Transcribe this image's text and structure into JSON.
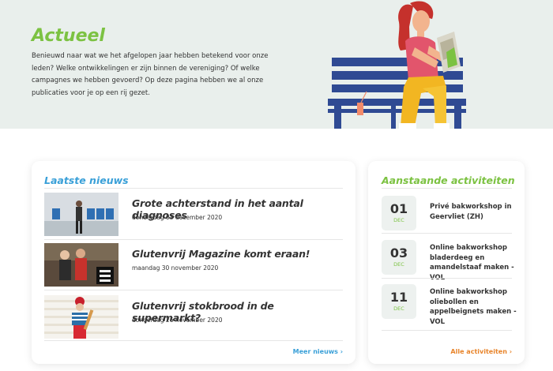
{
  "hero": {
    "title": "Actueel",
    "text": "Benieuwd naar wat we het afgelopen jaar hebben betekend voor onze leden? Welke ontwikkelingen er zijn binnen de vereniging? Of welke campagnes we hebben gevoerd? Op deze pagina hebben we al onze publicaties voor je op een rij gezet."
  },
  "news": {
    "title": "Laatste nieuws",
    "items": [
      {
        "headline": "Grote achterstand in het aantal diagnoses",
        "date": "donderdag 03 december 2020"
      },
      {
        "headline": "Glutenvrij Magazine komt eraan!",
        "date": "maandag 30 november 2020"
      },
      {
        "headline": "Glutenvrij stokbrood in de supermarkt?",
        "date": "donderdag 26 november 2020"
      }
    ],
    "more_label": "Meer nieuws ›"
  },
  "activities": {
    "title": "Aanstaande activiteiten",
    "items": [
      {
        "day": "01",
        "month": "DEC",
        "title": "Privé bakworkshop in Geervliet (ZH)"
      },
      {
        "day": "03",
        "month": "DEC",
        "title": "Online bakworkshop bladerdeeg en amandelstaaf maken - VOL"
      },
      {
        "day": "11",
        "month": "DEC",
        "title": "Online bakworkshop oliebollen en appelbeignets maken - VOL"
      }
    ],
    "more_label": "Alle activiteiten ›"
  },
  "colors": {
    "green": "#7cc242",
    "blue": "#3aa0d8",
    "orange": "#e8842a",
    "hero_bg": "#e9efec"
  }
}
